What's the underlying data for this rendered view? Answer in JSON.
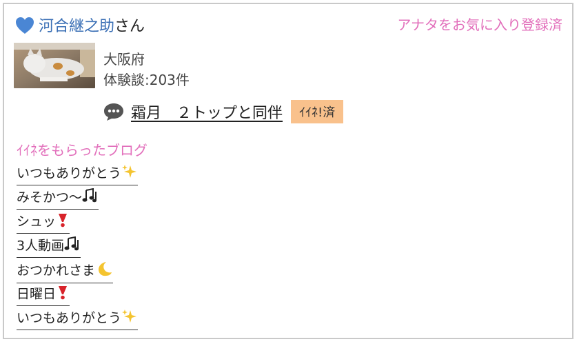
{
  "header": {
    "username": "河合継之助",
    "username_suffix": "さん",
    "favorite_status": "アナタをお気に入り登録済",
    "heart_color": "#4a86d4"
  },
  "profile": {
    "location": "大阪府",
    "experience_count": "体験談:203件"
  },
  "latest_post": {
    "title": "霜月　２トップと同伴",
    "badge": "ｲｲﾈ!済",
    "icon": "comment-bubble-icon"
  },
  "liked_section": {
    "title": "ｲｲﾈをもらったブログ",
    "items": [
      {
        "text": "いつもありがとう",
        "emoji": "sparkles"
      },
      {
        "text": "みそかつ〜",
        "emoji": "notes"
      },
      {
        "text": "シュッ",
        "emoji": "exclamation"
      },
      {
        "text": "3人動画",
        "emoji": "notes"
      },
      {
        "text": "おつかれさま",
        "emoji": "moon"
      },
      {
        "text": "日曜日",
        "emoji": "exclamation"
      },
      {
        "text": "いつもありがとう",
        "emoji": "sparkles"
      }
    ]
  },
  "colors": {
    "accent_pink": "#e26fbb",
    "name_blue": "#3a6fb5",
    "badge_bg": "#f9c18c",
    "border": "#c9c9c9"
  }
}
